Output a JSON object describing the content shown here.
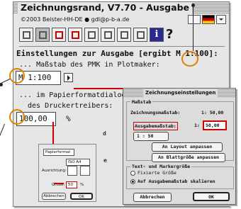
{
  "window": {
    "title": "Zeichnungsrand, V7.70 - Ausgabe",
    "copyright": "©2003 Beister-HH-DE ● gdl@p-b-a.de"
  },
  "toolbar": {
    "icons": [
      "frame-icon",
      "printer-icon",
      "border-icon",
      "border-red-icon",
      "pen-icon",
      "stripe-icon",
      "ruler-icon",
      "book-icon",
      "info-icon",
      "help-icon"
    ],
    "info_label": "i",
    "help_label": "?"
  },
  "main": {
    "heading": "Einstellungen zur Ausgabe [ergibt M 1:100]:",
    "scale_label": "... Maßstab des PMK in Plotmaker:",
    "scale_value": "M 1:100",
    "dialog_label_1": "... im Papierformatdialog",
    "dialog_label_2": "des Druckertreibers:",
    "percent_value": "100,00",
    "percent_unit": "%"
  },
  "page_setup": {
    "paper_format": "Papierformat",
    "paper_size": "ISO A4",
    "orientation_label": "Ausrichtung:",
    "size_label": "Größe:",
    "size_value": "50",
    "size_unit": "%",
    "cancel": "Abbrechen",
    "ok": "OK"
  },
  "drawing_settings": {
    "title": "Zeichnungseinstellungen",
    "scale_group": "Maßstab",
    "drawing_scale_label": "Zeichnungsmaßstab:",
    "drawing_scale_value": "1: 50,00",
    "output_scale_label": "Ausgabemaßstab:",
    "output_scale_prefix": "1:",
    "output_scale_value": "50,00",
    "scale_popup": "1 : 50",
    "adjust_layout": "An Layout anpassen",
    "adjust_sheet": "An Blattgröße anpassen",
    "text_group": "Text- und Markergröße",
    "radio_fixed": "Fixierte Größe",
    "radio_scale": "Auf Ausgabemaßstab skalieren",
    "cancel": "Abbrechen",
    "ok": "OK"
  },
  "accent_colors": {
    "connector": "#d00000",
    "highlight_circle": "#e08000"
  }
}
